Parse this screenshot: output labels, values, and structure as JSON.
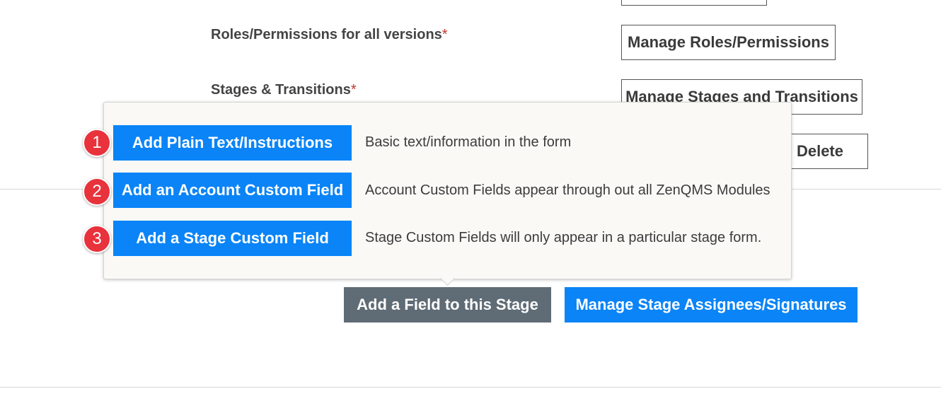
{
  "form": {
    "roles_label": "Roles/Permissions for all versions",
    "roles_required": "*",
    "stages_label": "Stages & Transitions",
    "stages_required": "*",
    "manage_roles_button": "Manage Roles/Permissions",
    "manage_stages_button": "Manage Stages and Transitions",
    "delete_button": "Delete"
  },
  "popover": {
    "options": [
      {
        "badge": "1",
        "button": "Add Plain Text/Instructions",
        "description": "Basic text/information in the form"
      },
      {
        "badge": "2",
        "button": "Add an Account Custom Field",
        "description": "Account Custom Fields appear through out all ZenQMS Modules"
      },
      {
        "badge": "3",
        "button": "Add a Stage Custom Field",
        "description": "Stage Custom Fields will only appear in a particular stage form."
      }
    ]
  },
  "actions": {
    "add_field_button": "Add a Field to this Stage",
    "manage_assignees_button": "Manage Stage Assignees/Signatures"
  },
  "colors": {
    "primary_blue": "#0a84f7",
    "gray_button": "#5f6b75",
    "badge_red": "#e8323c",
    "required_red": "#c0392b"
  }
}
